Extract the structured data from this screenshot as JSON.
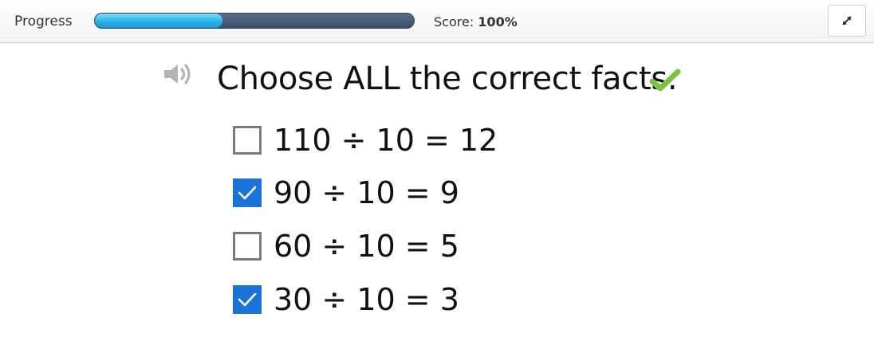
{
  "header": {
    "progress_label": "Progress",
    "progress_fraction": 0.4,
    "score_label": "Score:",
    "score_value": "100%",
    "expand_icon": "expand-icon"
  },
  "question": {
    "speaker_icon": "speaker-icon",
    "text": "Choose ALL the correct facts.",
    "status_icon": "checkmark-icon",
    "status_color": "#7cc242"
  },
  "options": [
    {
      "text": "110 ÷ 10 = 12",
      "checked": false
    },
    {
      "text": "90 ÷ 10 = 9",
      "checked": true
    },
    {
      "text": "60 ÷ 10 = 5",
      "checked": false
    },
    {
      "text": "30 ÷ 10 = 3",
      "checked": true
    }
  ],
  "colors": {
    "checkbox_checked": "#1a73d9",
    "progress_fill": "#2bb3e8",
    "progress_track": "#3a4d68"
  }
}
